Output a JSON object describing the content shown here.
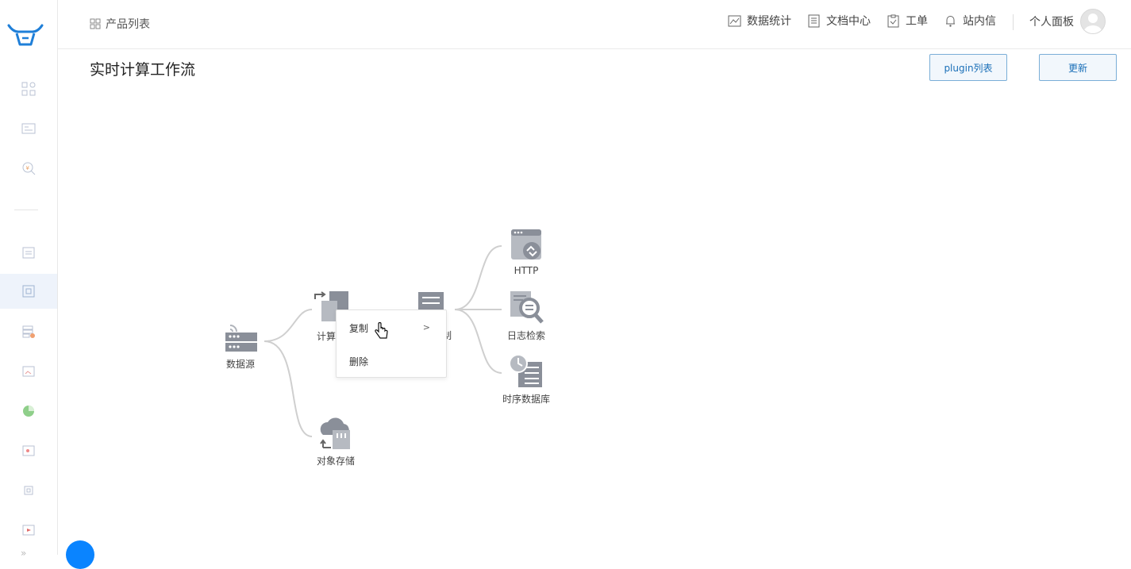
{
  "header": {
    "breadcrumb": "产品列表",
    "nav": [
      {
        "label": "数据统计",
        "icon": "chart-icon"
      },
      {
        "label": "文档中心",
        "icon": "document-icon"
      },
      {
        "label": "工单",
        "icon": "ticket-icon"
      },
      {
        "label": "站内信",
        "icon": "bell-icon"
      }
    ],
    "user_label": "个人面板"
  },
  "page": {
    "title": "实时计算工作流",
    "plugin_button": "plugin列表",
    "update_button": "更新"
  },
  "graph": {
    "nodes": {
      "source": "数据源",
      "compute": "计算",
      "hidden_partial": "制",
      "http": "HTTP",
      "log": "日志检索",
      "tsdb": "时序数据库",
      "object_storage": "对象存储"
    }
  },
  "context_menu": {
    "copy": "复制",
    "copy_arrow": ">",
    "delete": "删除"
  },
  "colors": {
    "accent": "#0a84ff",
    "button_border": "#7aaed7",
    "icon_gray": "#8a8f99"
  }
}
